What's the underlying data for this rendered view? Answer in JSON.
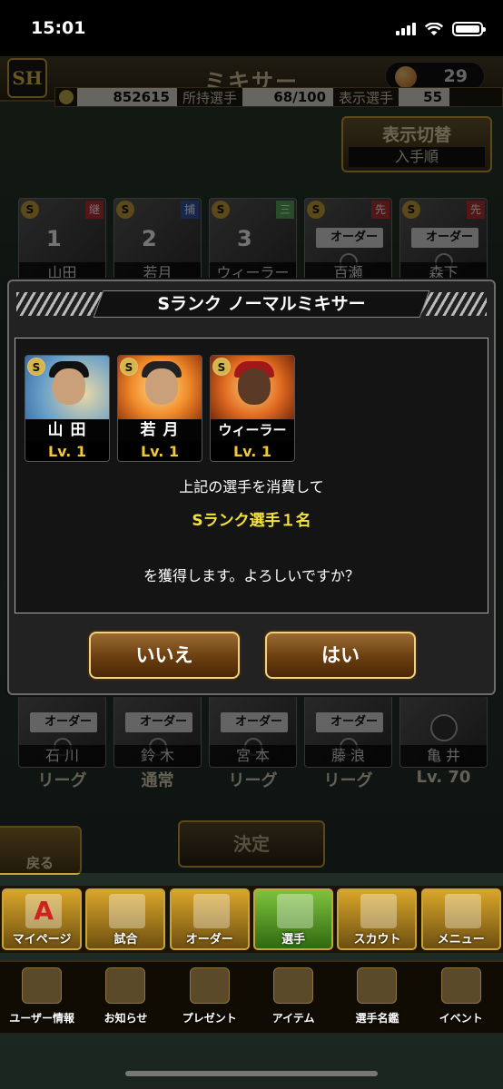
{
  "status_bar": {
    "time": "15:01"
  },
  "header": {
    "title": "ミキサー",
    "ball_count": "29",
    "coins": "852615",
    "owned_label": "所持選手",
    "owned_value": "68/100",
    "display_label": "表示選手",
    "display_value": "55",
    "view_switch_label": "表示切替",
    "view_switch_value": "入手順"
  },
  "background_cards_row1": [
    {
      "badge": "S",
      "pos": "継",
      "num": "1",
      "name": "山田"
    },
    {
      "badge": "S",
      "pos": "捕",
      "num": "2",
      "name": "若月"
    },
    {
      "badge": "S",
      "pos": "三",
      "num": "3",
      "name": "ウィーラー"
    },
    {
      "badge": "S",
      "pos": "先",
      "order": "オーダー",
      "name": "百瀬"
    },
    {
      "badge": "S",
      "pos": "先",
      "order": "オーダー",
      "name": "森下"
    }
  ],
  "background_cards_row2": [
    {
      "order": "オーダー",
      "name": "石 川",
      "sub": "リーグ"
    },
    {
      "order": "オーダー",
      "name": "鈴 木",
      "sub": "通常"
    },
    {
      "order": "オーダー",
      "name": "宮 本",
      "sub": "リーグ"
    },
    {
      "order": "オーダー",
      "name": "藤 浪",
      "sub": "リーグ"
    },
    {
      "order": "",
      "name": "亀 井",
      "sub": "Lv. 70"
    }
  ],
  "bottom": {
    "back_label": "戻る",
    "decide_label": "決定"
  },
  "nav_main": [
    {
      "label": "マイページ",
      "icon": "A"
    },
    {
      "label": "試合",
      "icon": ""
    },
    {
      "label": "オーダー",
      "icon": ""
    },
    {
      "label": "選手",
      "icon": ""
    },
    {
      "label": "スカウト",
      "icon": ""
    },
    {
      "label": "メニュー",
      "icon": ""
    }
  ],
  "nav_sub": [
    {
      "label": "ユーザー情報"
    },
    {
      "label": "お知らせ"
    },
    {
      "label": "プレゼント"
    },
    {
      "label": "アイテム"
    },
    {
      "label": "選手名鑑"
    },
    {
      "label": "イベント"
    }
  ],
  "modal": {
    "title": "Sランク ノーマルミキサー",
    "players": [
      {
        "badge": "S",
        "name": "山 田",
        "level": "Lv. 1"
      },
      {
        "badge": "S",
        "name": "若 月",
        "level": "Lv. 1"
      },
      {
        "badge": "S",
        "name": "ウィーラー",
        "level": "Lv. 1"
      }
    ],
    "message_line1": "上記の選手を消費して",
    "message_highlight": "Sランク選手１名",
    "message_line3": "を獲得します。よろしいですか？",
    "no_label": "いいえ",
    "yes_label": "はい"
  },
  "colors": {
    "accent_gold": "#c9a23a",
    "highlight_yellow": "#f5e33a"
  }
}
